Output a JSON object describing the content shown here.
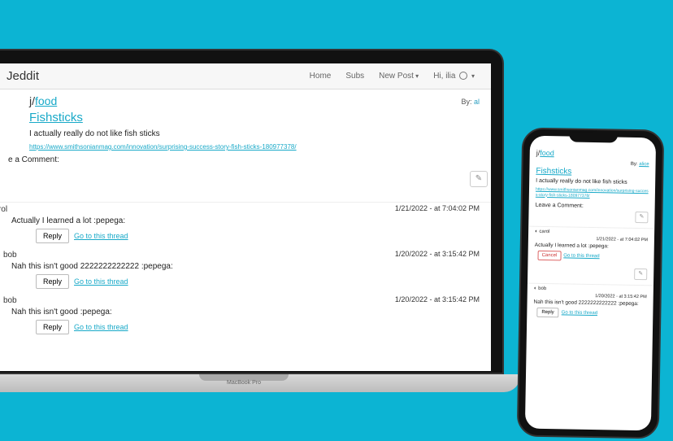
{
  "app": {
    "brand": "Jeddit",
    "laptop_label": "MacBook Pro"
  },
  "nav": {
    "home": "Home",
    "subs": "Subs",
    "newpost": "New Post",
    "greeting": "Hi, ilia"
  },
  "post": {
    "prefix": "j/",
    "sub": "food",
    "byline_prefix": "By: ",
    "author_truncated": "al",
    "author_full": "alice",
    "title": "Fishsticks",
    "body": "I actually really do not like fish sticks",
    "link": "https://www.smithsonianmag.com/innovation/surprising-success-story-fish-sticks-180977378/",
    "link_wrapped": "https://www.smithsonianmag.com/innovation/surprising-success-story-fish-sticks-180977378/",
    "leave_label": "Leave a Comment:",
    "leave_label_truncated": "e a Comment:",
    "send_icon": "✎"
  },
  "buttons": {
    "reply": "Reply",
    "cancel": "Cancel",
    "thread": "Go to this thread"
  },
  "comments": [
    {
      "user": "carol",
      "user_truncated": "rol",
      "date": "1/21/2022 - at 7:04:02 PM",
      "body": "Actually I learned a lot :pepega:"
    },
    {
      "user": "bob",
      "date": "1/20/2022 - at 3:15:42 PM",
      "body": "Nah this isn't good 2222222222222 :pepega:"
    },
    {
      "user": "bob",
      "date": "1/20/2022 - at 3:15:42 PM",
      "body": "Nah this isn't good :pepega:"
    }
  ],
  "phone_comments": [
    {
      "user": "carol",
      "date": "1/21/2022 - at 7:04:02 PM",
      "body": "Actually I learned a lot :pepega:",
      "show_cancel": true
    },
    {
      "user": "bob",
      "date": "1/20/2022 - at 3:15:42 PM",
      "body": "Nah this isn't good 2222222222222 :pepega:",
      "show_cancel": false
    }
  ]
}
